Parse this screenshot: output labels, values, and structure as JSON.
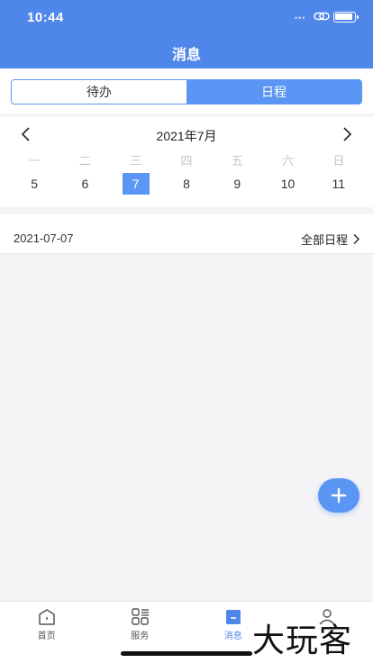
{
  "status_bar": {
    "time": "10:44",
    "dots": "•••"
  },
  "nav": {
    "title": "消息"
  },
  "segment": {
    "tabs": [
      {
        "label": "待办",
        "active": false
      },
      {
        "label": "日程",
        "active": true
      }
    ]
  },
  "calendar": {
    "month_label": "2021年7月",
    "weekdays": [
      "一",
      "二",
      "三",
      "四",
      "五",
      "六",
      "日"
    ],
    "dates": [
      "5",
      "6",
      "7",
      "8",
      "9",
      "10",
      "11"
    ],
    "selected_date": "7"
  },
  "schedule": {
    "date": "2021-07-07",
    "view_all_label": "全部日程"
  },
  "fab": {
    "icon": "plus-icon"
  },
  "tabbar": {
    "items": [
      {
        "label": "首页",
        "icon": "home-icon",
        "active": false
      },
      {
        "label": "服务",
        "icon": "grid-icon",
        "active": false
      },
      {
        "label": "消息",
        "icon": "message-icon",
        "active": true
      },
      {
        "label": "",
        "icon": "profile-icon",
        "active": false
      }
    ]
  },
  "watermark": {
    "text": "大玩客"
  },
  "colors": {
    "primary": "#4f86ea",
    "accent": "#5b96f4",
    "background": "#f4f4f6"
  }
}
